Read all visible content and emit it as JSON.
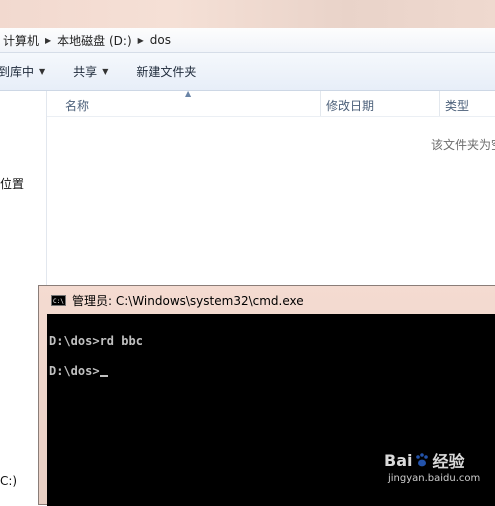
{
  "breadcrumb": {
    "items": [
      "计算机",
      "本地磁盘 (D:)",
      "dos"
    ]
  },
  "toolbar": {
    "include_label": "到库中",
    "share_label": "共享",
    "new_folder_label": "新建文件夹"
  },
  "navpane": {
    "location_fragment": "位置",
    "drive_fragment": "C:)"
  },
  "columns": {
    "name": "名称",
    "date": "修改日期",
    "type": "类型"
  },
  "empty_message": "该文件夹为空",
  "cmd": {
    "title": "管理员: C:\\Windows\\system32\\cmd.exe",
    "icon_text": "C:\\",
    "line1": "D:\\dos>rd bbc",
    "line2": "D:\\dos>"
  },
  "watermark": {
    "brand": "Bai",
    "brand_suffix": "经验",
    "url": "jingyan.baidu.com"
  },
  "colors": {
    "console_bg": "#000000",
    "console_text": "#c0c0c0",
    "cmd_frame": "#f4dbd1"
  }
}
